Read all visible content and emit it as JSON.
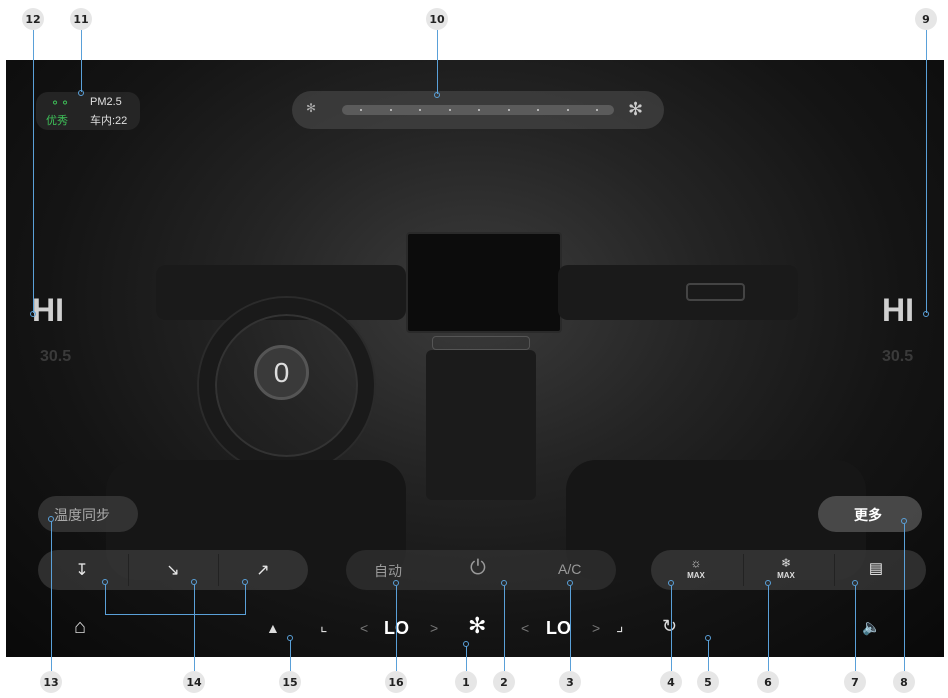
{
  "callouts": [
    "12",
    "11",
    "10",
    "9",
    "13",
    "14",
    "15",
    "16",
    "1",
    "2",
    "3",
    "4",
    "5",
    "6",
    "7",
    "8"
  ],
  "air_quality": {
    "icon": "car-air-icon",
    "label": "PM2.5",
    "rating": "优秀",
    "value": "车内:22"
  },
  "fan_slider": {
    "steps": 9,
    "level_fraction": 0.0
  },
  "left_temp": {
    "value": "HI",
    "sub": "30.5"
  },
  "right_temp": {
    "value": "HI",
    "sub": "30.5"
  },
  "sync_button": "温度同步",
  "more_button": "更多",
  "center_buttons": {
    "auto": "自动",
    "power_icon": "power-icon",
    "ac": "A/C"
  },
  "right_buttons": {
    "max_heat": "MAX",
    "max_cool": "MAX",
    "rear_defrost_icon": "rear-defrost-icon"
  },
  "bottom_bar": {
    "left_level": "LO",
    "right_level": "LO",
    "left_arrow": "<",
    "right_arrow": ">"
  },
  "colors": {
    "accent_blue": "#5aa0d8",
    "good_green": "#3fc35a"
  }
}
